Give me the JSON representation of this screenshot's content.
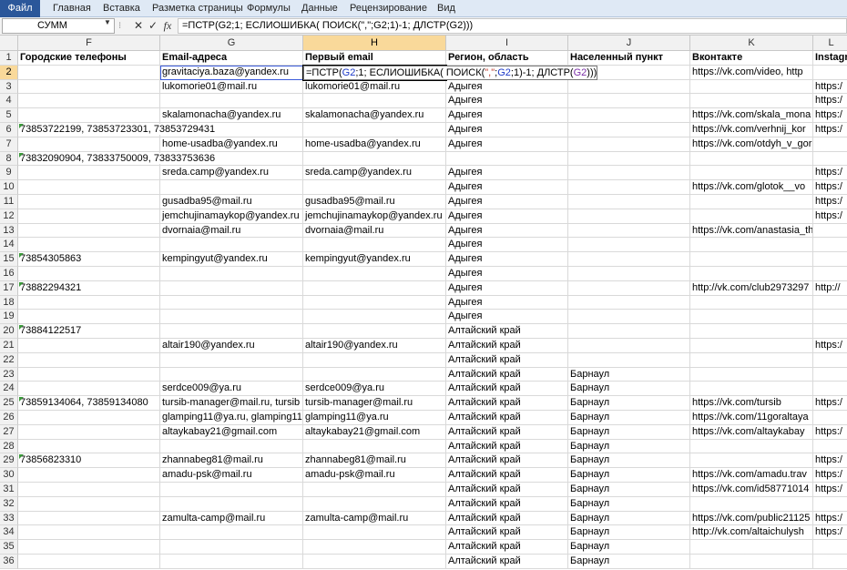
{
  "ribbon": {
    "tabs": [
      "Файл",
      "Главная",
      "Вставка",
      "Разметка страницы",
      "Формулы",
      "Данные",
      "Рецензирование",
      "Вид"
    ]
  },
  "formula_bar": {
    "name_box": "СУММ",
    "formula": "=ПСТР(G2;1; ЕСЛИОШИБКА( ПОИСК(\",\";G2;1)-1; ДЛСТР(G2)))",
    "cancel_icon": "cancel-x-icon",
    "enter_icon": "enter-check-icon",
    "function_icon": "fx-icon"
  },
  "edit_cell": {
    "parts": [
      "=ПСТР(",
      "G2",
      ";1; ЕСЛИОШИБКА( ПОИСК(",
      "\",\"",
      ";",
      "G2",
      ";1)-1; ДЛСТР(",
      "G2",
      ")))"
    ]
  },
  "columns": [
    {
      "letter": "F",
      "header": "Городские телефоны"
    },
    {
      "letter": "G",
      "header": "Email-адреса"
    },
    {
      "letter": "H",
      "header": "Первый email"
    },
    {
      "letter": "I",
      "header": "Регион, область"
    },
    {
      "letter": "J",
      "header": "Населенный пункт"
    },
    {
      "letter": "K",
      "header": "Вконтакте"
    },
    {
      "letter": "L",
      "header": "Instagr"
    }
  ],
  "rows": [
    {
      "n": "2",
      "F": "",
      "G": "gravitaciya.baza@yandex.ru",
      "H": "",
      "I": "",
      "J": "",
      "K": "https://vk.com/video, http",
      "L": ""
    },
    {
      "n": "3",
      "F": "",
      "G": "lukomorie01@mail.ru",
      "H": "lukomorie01@mail.ru",
      "I": "Адыгея",
      "J": "",
      "K": "",
      "L": "https:/"
    },
    {
      "n": "4",
      "F": "",
      "G": "",
      "H": "",
      "I": "Адыгея",
      "J": "",
      "K": "",
      "L": "https:/"
    },
    {
      "n": "5",
      "F": "",
      "G": "skalamonacha@yandex.ru",
      "H": "skalamonacha@yandex.ru",
      "I": "Адыгея",
      "J": "",
      "K": "https://vk.com/skala_mona",
      "L": "https:/"
    },
    {
      "n": "6",
      "F": "73853722199, 73853723301, 73853729431",
      "G": "",
      "H": "",
      "I": "Адыгея",
      "J": "",
      "K": "https://vk.com/verhnij_kor",
      "L": "https:/"
    },
    {
      "n": "7",
      "F": "",
      "G": "home-usadba@yandex.ru",
      "H": "home-usadba@yandex.ru",
      "I": "Адыгея",
      "J": "",
      "K": "https://vk.com/otdyh_v_gorah_ad",
      "L": ""
    },
    {
      "n": "8",
      "F": "73832090904, 73833750009, 73833753636",
      "G": "",
      "H": "",
      "I": "",
      "J": "",
      "K": "",
      "L": ""
    },
    {
      "n": "9",
      "F": "",
      "G": "sreda.camp@yandex.ru",
      "H": "sreda.camp@yandex.ru",
      "I": "Адыгея",
      "J": "",
      "K": "",
      "L": "https:/"
    },
    {
      "n": "10",
      "F": "",
      "G": "",
      "H": "",
      "I": "Адыгея",
      "J": "",
      "K": "https://vk.com/glotok__vo",
      "L": "https:/"
    },
    {
      "n": "11",
      "F": "",
      "G": "gusadba95@mail.ru",
      "H": "gusadba95@mail.ru",
      "I": "Адыгея",
      "J": "",
      "K": "",
      "L": "https:/"
    },
    {
      "n": "12",
      "F": "",
      "G": "jemchujinamaykop@yandex.ru",
      "H": "jemchujinamaykop@yandex.ru",
      "I": "Адыгея",
      "J": "",
      "K": "",
      "L": "https:/"
    },
    {
      "n": "13",
      "F": "",
      "G": "dvornaia@mail.ru",
      "H": "dvornaia@mail.ru",
      "I": "Адыгея",
      "J": "",
      "K": "https://vk.com/anastasia_thermal",
      "L": ""
    },
    {
      "n": "14",
      "F": "",
      "G": "",
      "H": "",
      "I": "Адыгея",
      "J": "",
      "K": "",
      "L": ""
    },
    {
      "n": "15",
      "F": "73854305863",
      "G": "kempingyut@yandex.ru",
      "H": "kempingyut@yandex.ru",
      "I": "Адыгея",
      "J": "",
      "K": "",
      "L": ""
    },
    {
      "n": "16",
      "F": "",
      "G": "",
      "H": "",
      "I": "Адыгея",
      "J": "",
      "K": "",
      "L": ""
    },
    {
      "n": "17",
      "F": "73882294321",
      "G": "",
      "H": "",
      "I": "Адыгея",
      "J": "",
      "K": "http://vk.com/club2973297",
      "L": "http://"
    },
    {
      "n": "18",
      "F": "",
      "G": "",
      "H": "",
      "I": "Адыгея",
      "J": "",
      "K": "",
      "L": ""
    },
    {
      "n": "19",
      "F": "",
      "G": "",
      "H": "",
      "I": "Адыгея",
      "J": "",
      "K": "",
      "L": ""
    },
    {
      "n": "20",
      "F": "73884122517",
      "G": "",
      "H": "",
      "I": "Алтайский край",
      "J": "",
      "K": "",
      "L": ""
    },
    {
      "n": "21",
      "F": "",
      "G": "altair190@yandex.ru",
      "H": "altair190@yandex.ru",
      "I": "Алтайский край",
      "J": "",
      "K": "",
      "L": "https:/"
    },
    {
      "n": "22",
      "F": "",
      "G": "",
      "H": "",
      "I": "Алтайский край",
      "J": "",
      "K": "",
      "L": ""
    },
    {
      "n": "23",
      "F": "",
      "G": "",
      "H": "",
      "I": "Алтайский край",
      "J": "Барнаул",
      "K": "",
      "L": ""
    },
    {
      "n": "24",
      "F": "",
      "G": "serdce009@ya.ru",
      "H": "serdce009@ya.ru",
      "I": "Алтайский край",
      "J": "Барнаул",
      "K": "",
      "L": ""
    },
    {
      "n": "25",
      "F": "73859134064, 73859134080",
      "G": "tursib-manager@mail.ru, tursib",
      "H": "tursib-manager@mail.ru",
      "I": "Алтайский край",
      "J": "Барнаул",
      "K": "https://vk.com/tursib",
      "L": "https:/"
    },
    {
      "n": "26",
      "F": "",
      "G": "glamping11@ya.ru, glamping11",
      "H": "glamping11@ya.ru",
      "I": "Алтайский край",
      "J": "Барнаул",
      "K": "https://vk.com/11goraltaya",
      "L": ""
    },
    {
      "n": "27",
      "F": "",
      "G": "altaykabay21@gmail.com",
      "H": "altaykabay21@gmail.com",
      "I": "Алтайский край",
      "J": "Барнаул",
      "K": "https://vk.com/altaykabay",
      "L": "https:/"
    },
    {
      "n": "28",
      "F": "",
      "G": "",
      "H": "",
      "I": "Алтайский край",
      "J": "Барнаул",
      "K": "",
      "L": ""
    },
    {
      "n": "29",
      "F": "73856823310",
      "G": "zhannabeg81@mail.ru",
      "H": "zhannabeg81@mail.ru",
      "I": "Алтайский край",
      "J": "Барнаул",
      "K": "",
      "L": "https:/"
    },
    {
      "n": "30",
      "F": "",
      "G": "amadu-psk@mail.ru",
      "H": "amadu-psk@mail.ru",
      "I": "Алтайский край",
      "J": "Барнаул",
      "K": "https://vk.com/amadu.trav",
      "L": "https:/"
    },
    {
      "n": "31",
      "F": "",
      "G": "",
      "H": "",
      "I": "Алтайский край",
      "J": "Барнаул",
      "K": "https://vk.com/id58771014",
      "L": "https:/"
    },
    {
      "n": "32",
      "F": "",
      "G": "",
      "H": "",
      "I": "Алтайский край",
      "J": "Барнаул",
      "K": "",
      "L": ""
    },
    {
      "n": "33",
      "F": "",
      "G": "zamulta-camp@mail.ru",
      "H": "zamulta-camp@mail.ru",
      "I": "Алтайский край",
      "J": "Барнаул",
      "K": "https://vk.com/public21125",
      "L": "https:/"
    },
    {
      "n": "34",
      "F": "",
      "G": "",
      "H": "",
      "I": "Алтайский край",
      "J": "Барнаул",
      "K": "http://vk.com/altaichulysh",
      "L": "https:/"
    },
    {
      "n": "35",
      "F": "",
      "G": "",
      "H": "",
      "I": "Алтайский край",
      "J": "Барнаул",
      "K": "",
      "L": ""
    },
    {
      "n": "36",
      "F": "",
      "G": "",
      "H": "",
      "I": "Алтайский край",
      "J": "Барнаул",
      "K": "",
      "L": ""
    }
  ],
  "header_row_number": "1",
  "tri_rows": [
    "6",
    "8",
    "15",
    "17",
    "20",
    "25",
    "29"
  ],
  "spill_rows": [
    "6",
    "8"
  ],
  "active_cell": "H2",
  "colors": {
    "file_tab": "#2b579a",
    "header_selected": "#f9d99a",
    "ref_blue": "#1c39c8",
    "error_triangle": "#3a9a3a"
  }
}
